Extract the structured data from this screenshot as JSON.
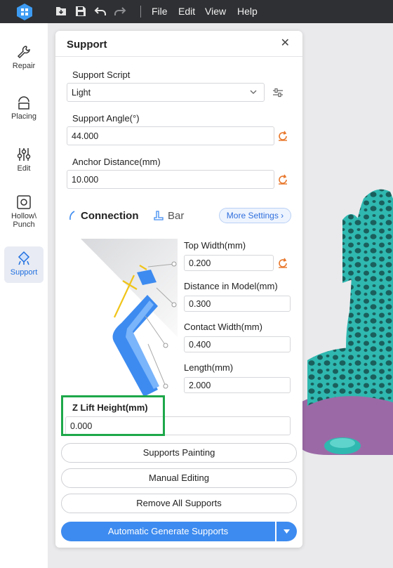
{
  "menu": {
    "file": "File",
    "edit": "Edit",
    "view": "View",
    "help": "Help"
  },
  "toolbar_icons": [
    "import-icon",
    "save-icon",
    "undo-icon",
    "redo-icon"
  ],
  "sidebar": {
    "items": [
      {
        "label": "Repair",
        "icon": "wrench-icon"
      },
      {
        "label": "Placing",
        "icon": "placing-icon"
      },
      {
        "label": "Edit",
        "icon": "sliders-icon"
      },
      {
        "label": "Hollow\\",
        "label2": "Punch",
        "icon": "hollow-icon"
      },
      {
        "label": "Support",
        "icon": "support-icon"
      }
    ],
    "active": "Support"
  },
  "panel": {
    "title": "Support",
    "support_script": {
      "label": "Support Script",
      "value": "Light"
    },
    "support_angle": {
      "label": "Support Angle(°)",
      "value": "44.000"
    },
    "anchor_distance": {
      "label": "Anchor Distance(mm)",
      "value": "10.000"
    },
    "tabs": {
      "connection": "Connection",
      "bar": "Bar",
      "active": "Connection"
    },
    "more_settings": "More Settings",
    "top_width": {
      "label": "Top Width(mm)",
      "value": "0.200"
    },
    "distance_in_model": {
      "label": "Distance in Model(mm)",
      "value": "0.300"
    },
    "contact_width": {
      "label": "Contact Width(mm)",
      "value": "0.400"
    },
    "length": {
      "label": "Length(mm)",
      "value": "2.000"
    },
    "z_lift_height": {
      "label": "Z Lift Height(mm)",
      "value": "0.000"
    },
    "buttons": {
      "supports_painting": "Supports Painting",
      "manual_editing": "Manual Editing",
      "remove_all": "Remove All Supports",
      "auto_generate": "Automatic Generate Supports"
    }
  },
  "colors": {
    "accent": "#3d8bf0",
    "highlight": "#1ea84a",
    "reset": "#e8762a",
    "model": "#2fb8b0",
    "base": "#9b6aa6"
  }
}
